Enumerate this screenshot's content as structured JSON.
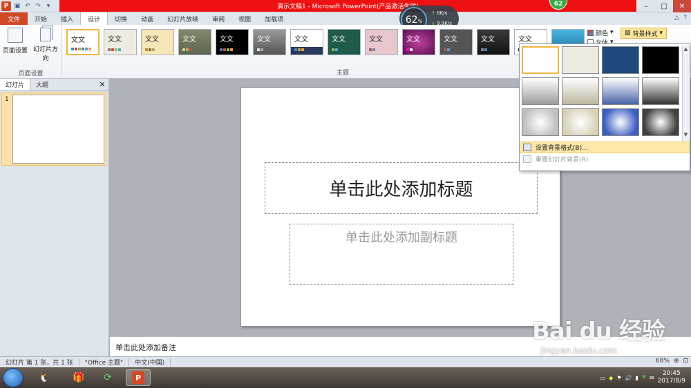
{
  "window": {
    "title": "演示文稿1 - Microsoft PowerPoint(产品激活失败)",
    "logo_letter": "P",
    "badge": "62",
    "min": "–",
    "max": "□",
    "close": "✕"
  },
  "speed_widget": {
    "percent": "62",
    "unit": "%",
    "upload": "0K/s",
    "download": "9.9K/s"
  },
  "tabs": [
    "文件",
    "开始",
    "插入",
    "设计",
    "切换",
    "动画",
    "幻灯片放映",
    "审阅",
    "视图",
    "加载项"
  ],
  "active_tab": "设计",
  "ribbon": {
    "page_setup": {
      "btn1": "页面设置",
      "btn2": "幻灯片方向",
      "group": "页面设置"
    },
    "themes_group": "主题",
    "theme_text": "文文",
    "colors": "颜色",
    "fonts": "文体",
    "bg_styles": "背景样式"
  },
  "left_pane": {
    "tab_slides": "幻灯片",
    "tab_outline": "大纲",
    "close": "✕",
    "slide_num": "1"
  },
  "slide": {
    "title_placeholder": "单击此处添加标题",
    "subtitle_placeholder": "单击此处添加副标题"
  },
  "notes": "单击此处添加备注",
  "status": {
    "slide_info": "幻灯片 第 1 张，共 1 张",
    "theme": "\"Office 主题\"",
    "language": "中文(中国)",
    "zoom": "68%"
  },
  "dropdown": {
    "item1": "设置背景格式(B)...",
    "item2": "重置幻灯片背景(R)",
    "backgrounds": [
      {
        "name": "white",
        "color": "#ffffff"
      },
      {
        "name": "cream",
        "color": "#eeece1"
      },
      {
        "name": "navy",
        "color": "#1f497d"
      },
      {
        "name": "black",
        "color": "#000000"
      },
      {
        "name": "gray-gradient",
        "color": "#9c9c9c"
      },
      {
        "name": "cream-gradient",
        "color": "#bcb6a0"
      },
      {
        "name": "blue-gradient",
        "color": "#4a64a8"
      },
      {
        "name": "dark-gradient",
        "color": "#333333"
      },
      {
        "name": "gray-radial",
        "color": "#c0c0c0"
      },
      {
        "name": "cream-radial",
        "color": "#d8d2b8"
      },
      {
        "name": "blue-radial",
        "color": "#3a5ec0"
      },
      {
        "name": "dark-radial",
        "color": "#404040"
      }
    ]
  },
  "taskbar": {
    "time": "20:45",
    "date": "2017/8/9"
  },
  "watermark": {
    "brand": "Bai du 经验",
    "url": "jingyan.baidu.com"
  },
  "colors": {
    "file_tab": "#d24726",
    "title_red": "#ee1111",
    "highlight": "#f2b63f"
  }
}
